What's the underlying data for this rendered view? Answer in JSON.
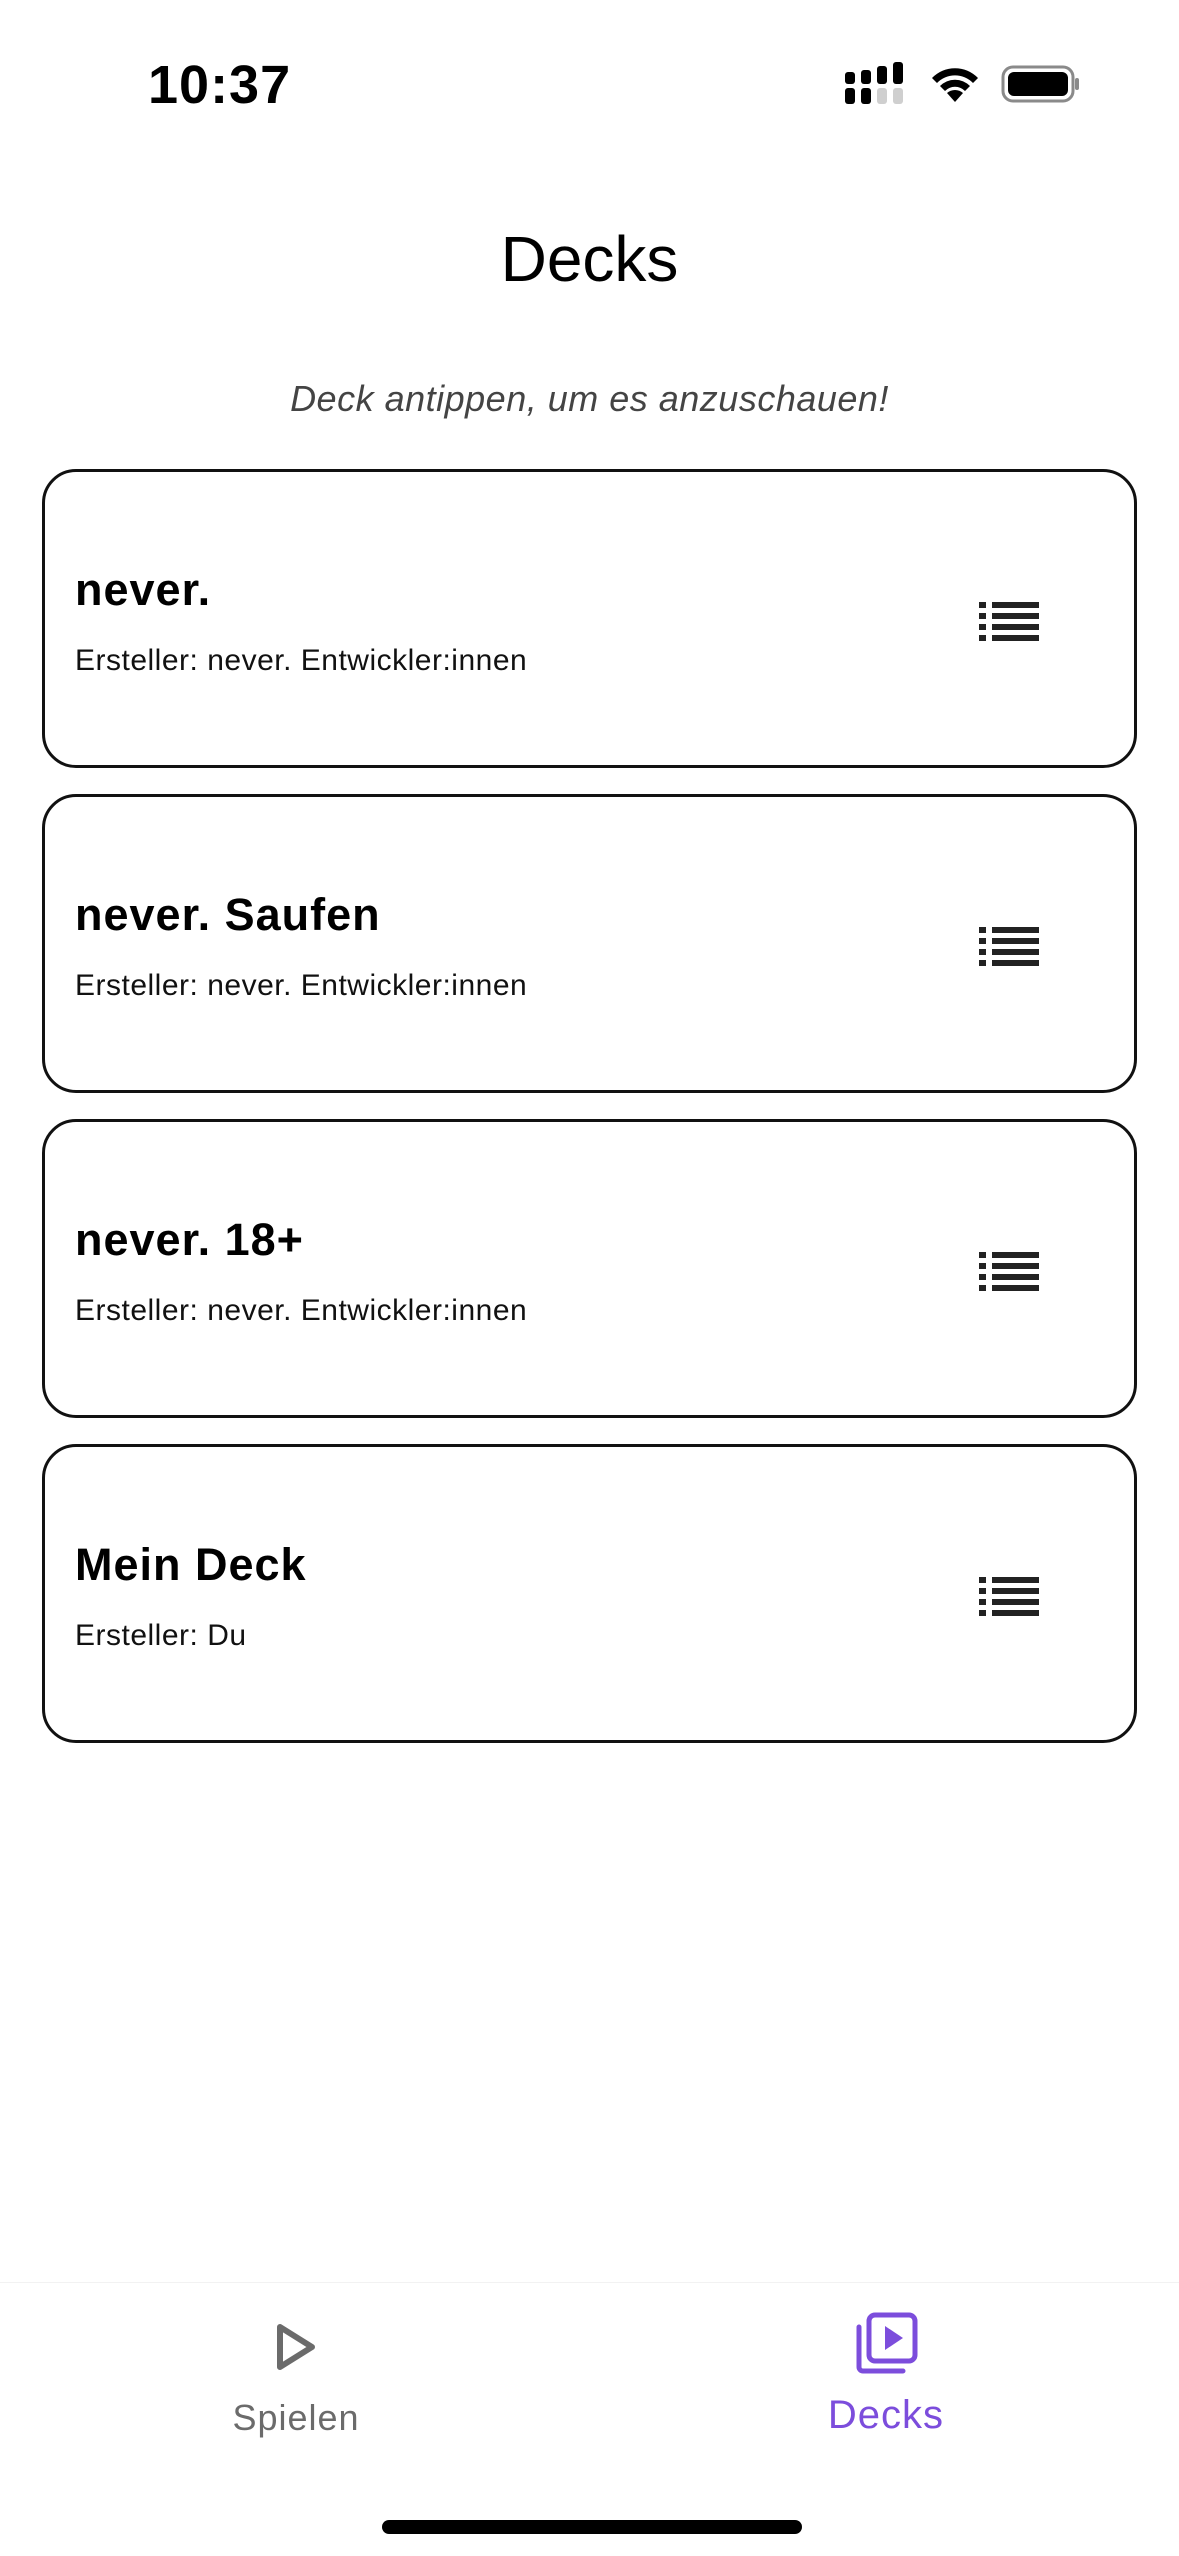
{
  "status_bar": {
    "time": "10:37",
    "icons": [
      "cellular-signal-icon",
      "wifi-icon",
      "battery-icon"
    ]
  },
  "header": {
    "title": "Decks",
    "hint": "Deck antippen, um es anzuschauen!"
  },
  "decks": [
    {
      "name": "never.",
      "creator": "Ersteller: never. Entwickler:innen"
    },
    {
      "name": "never. Saufen",
      "creator": "Ersteller: never. Entwickler:innen"
    },
    {
      "name": "never. 18+",
      "creator": "Ersteller: never. Entwickler:innen"
    },
    {
      "name": "Mein Deck",
      "creator": "Ersteller: Du"
    }
  ],
  "bottom_nav": {
    "items": [
      {
        "label": "Spielen",
        "icon": "play-icon",
        "active": false
      },
      {
        "label": "Decks",
        "icon": "video-library-icon",
        "active": true
      }
    ]
  },
  "colors": {
    "accent": "#7c4ddc",
    "inactive": "#6b6b6b",
    "card_border": "#111111"
  }
}
